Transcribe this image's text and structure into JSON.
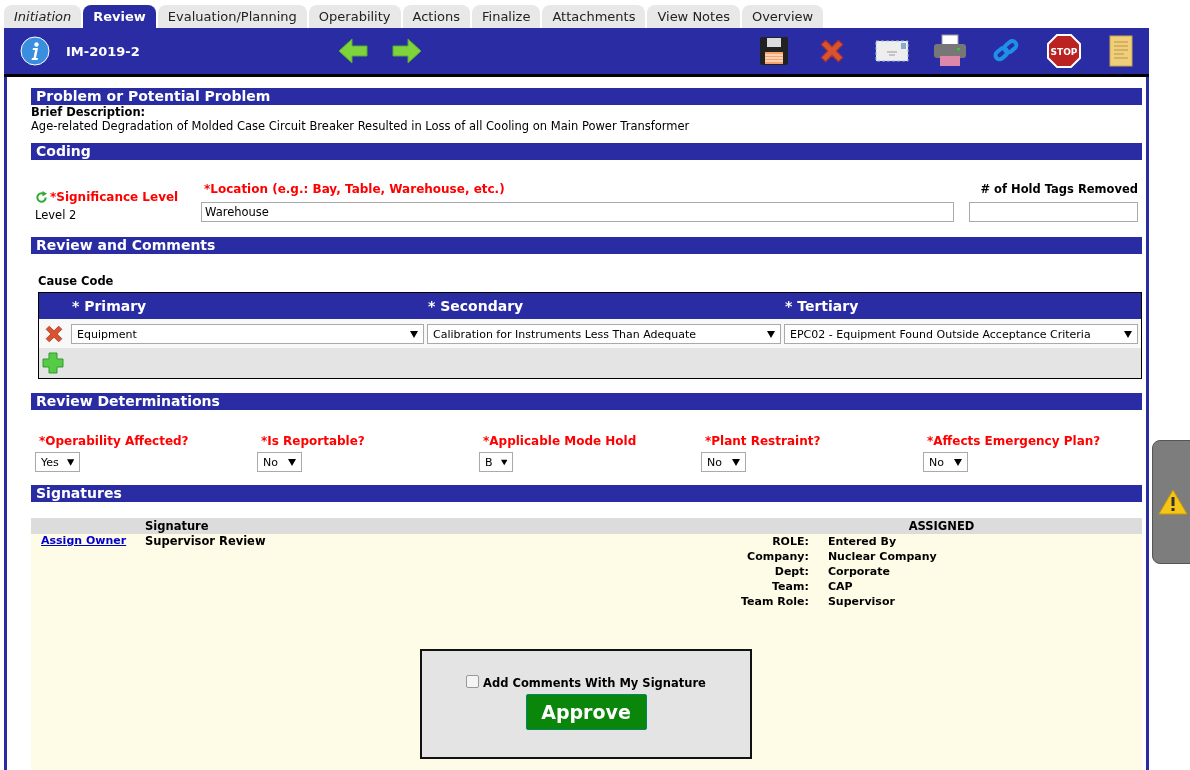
{
  "tabs": [
    {
      "label": "Initiation",
      "selected": false,
      "completed": true
    },
    {
      "label": "Review",
      "selected": true,
      "completed": false
    },
    {
      "label": "Evaluation/Planning",
      "selected": false,
      "completed": false
    },
    {
      "label": "Operability",
      "selected": false,
      "completed": false
    },
    {
      "label": "Actions",
      "selected": false,
      "completed": false
    },
    {
      "label": "Finalize",
      "selected": false,
      "completed": false
    },
    {
      "label": "Attachments",
      "selected": false,
      "completed": false
    },
    {
      "label": "View Notes",
      "selected": false,
      "completed": false
    },
    {
      "label": "Overview",
      "selected": false,
      "completed": false
    }
  ],
  "toolbar": {
    "record_id": "IM-2019-2",
    "stop_sign_text": "STOP"
  },
  "problem": {
    "title": "Problem or Potential Problem",
    "label": "Brief Description:",
    "text": "Age-related Degradation of Molded Case Circuit Breaker Resulted in Loss of all Cooling on Main Power Transformer"
  },
  "coding": {
    "title": "Coding",
    "significance": {
      "label": "*Significance Level",
      "value": "Level 2"
    },
    "location": {
      "label": "*Location (e.g.: Bay, Table, Warehouse, etc.)",
      "value": "Warehouse"
    },
    "hold_tags": {
      "label": "# of Hold Tags Removed"
    }
  },
  "review": {
    "title": "Review and Comments",
    "cause_code_label": "Cause Code",
    "columns": [
      "* Primary",
      "* Secondary",
      "* Tertiary"
    ],
    "rows": [
      {
        "primary": "Equipment",
        "secondary": "Calibration for Instruments Less Than Adequate",
        "tertiary": "EPC02 - Equipment Found Outside Acceptance Criteria"
      }
    ]
  },
  "determinations": {
    "title": "Review Determinations",
    "fields": [
      {
        "label": "*Operability Affected?",
        "value": "Yes"
      },
      {
        "label": "*Is Reportable?",
        "value": "No"
      },
      {
        "label": "*Applicable Mode Hold",
        "value": "B"
      },
      {
        "label": "*Plant Restraint?",
        "value": "No"
      },
      {
        "label": "*Affects Emergency Plan?",
        "value": "No"
      }
    ]
  },
  "signatures": {
    "title": "Signatures",
    "header": {
      "signature": "Signature",
      "assigned": "ASSIGNED"
    },
    "row": {
      "link": "Assign Owner",
      "signature": "Supervisor Review",
      "details": [
        {
          "label": "ROLE:",
          "value": "Entered By"
        },
        {
          "label": "Company:",
          "value": "Nuclear Company"
        },
        {
          "label": "Dept:",
          "value": "Corporate"
        },
        {
          "label": "Team:",
          "value": "CAP"
        },
        {
          "label": "Team Role:",
          "value": "Supervisor"
        }
      ]
    },
    "approval": {
      "comment_label": "Add Comments With My Signature",
      "checked": false,
      "button": "Approve"
    }
  }
}
